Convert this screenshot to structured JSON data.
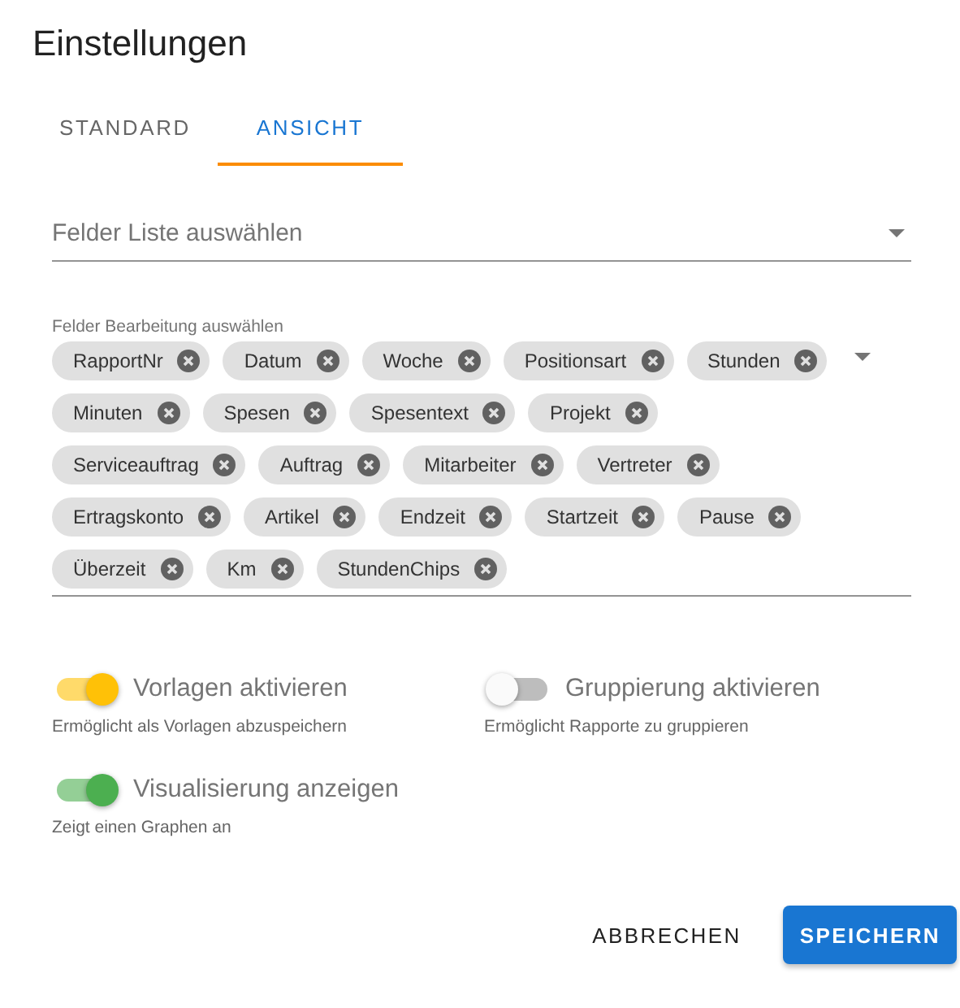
{
  "title": "Einstellungen",
  "tabs": [
    {
      "label": "STANDARD",
      "selected": false
    },
    {
      "label": "ANSICHT",
      "selected": true
    }
  ],
  "list_select": {
    "placeholder": "Felder Liste auswählen"
  },
  "edit_select": {
    "label": "Felder Bearbeitung auswählen",
    "chips": [
      "RapportNr",
      "Datum",
      "Woche",
      "Positionsart",
      "Stunden",
      "Minuten",
      "Spesen",
      "Spesentext",
      "Projekt",
      "Serviceauftrag",
      "Auftrag",
      "Mitarbeiter",
      "Vertreter",
      "Ertragskonto",
      "Artikel",
      "Endzeit",
      "Startzeit",
      "Pause",
      "Überzeit",
      "Km",
      "StundenChips"
    ]
  },
  "toggles": [
    {
      "label": "Vorlagen aktivieren",
      "description": "Ermöglicht als Vorlagen abzuspeichern",
      "on": true,
      "color": "#ffc107"
    },
    {
      "label": "Gruppierung aktivieren",
      "description": "Ermöglicht Rapporte zu gruppieren",
      "on": false
    },
    {
      "label": "Visualisierung anzeigen",
      "description": "Zeigt einen Graphen an",
      "on": true,
      "color": "#4caf50"
    }
  ],
  "buttons": [
    {
      "label": "ABBRECHEN",
      "kind": "text"
    },
    {
      "label": "SPEICHERN",
      "kind": "primary"
    }
  ]
}
